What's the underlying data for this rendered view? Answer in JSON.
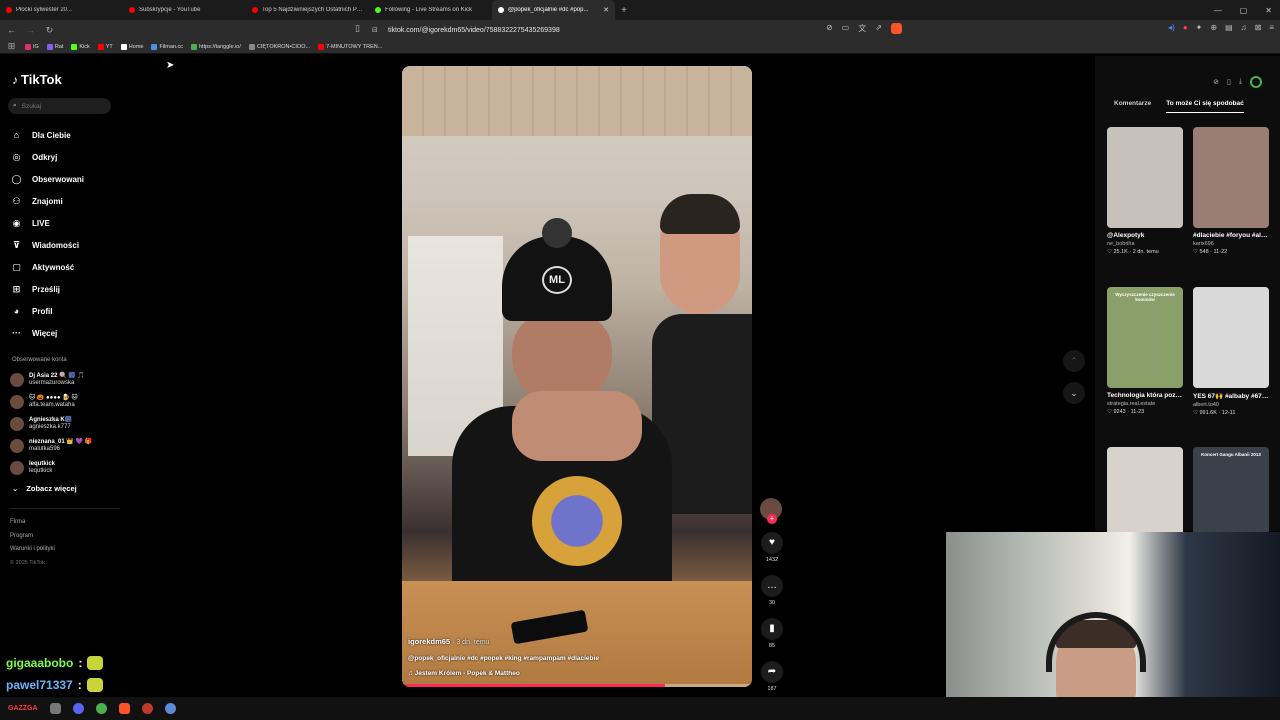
{
  "browser": {
    "tabs": [
      {
        "title": "Płocki sylwester 20...",
        "color": "#ff0000",
        "active": false
      },
      {
        "title": "Subskrypcje - YouTube",
        "color": "#ff0000",
        "active": false
      },
      {
        "title": "Top 5 Najdziwniejszych Ostatnich Po...",
        "color": "#ff0000",
        "active": false
      },
      {
        "title": "Following - Live Streams on Kick",
        "color": "#53fc18",
        "active": false
      },
      {
        "title": "@popek_oficjalnie #dc #pop...",
        "color": "#ffffff",
        "active": true
      }
    ],
    "new_tab_label": "+",
    "url": "tiktok.com/@igorekdm65/video/7588322275435269398",
    "bookmarks": [
      {
        "label": "IG",
        "color": "#e1306c"
      },
      {
        "label": "Rat",
        "color": "#8a5cf6"
      },
      {
        "label": "Kick",
        "color": "#53fc18"
      },
      {
        "label": "YT",
        "color": "#ff0000"
      },
      {
        "label": "Home",
        "color": "#ffffff"
      },
      {
        "label": "Filman.cc",
        "color": "#4a90e2"
      },
      {
        "label": "https://tanggle.io/",
        "color": "#4caf50"
      },
      {
        "label": "CIĘTOKRON•CIOO...",
        "color": "#888888"
      },
      {
        "label": "7-MINUTOWY TREN...",
        "color": "#ff0000"
      }
    ]
  },
  "sidebar": {
    "logo": "TikTok",
    "search_placeholder": "Szukaj",
    "menu": [
      {
        "label": "Dla Ciebie",
        "icon": "home-icon",
        "glyph": "⌂"
      },
      {
        "label": "Odkryj",
        "icon": "compass-icon",
        "glyph": "◎"
      },
      {
        "label": "Obserwowani",
        "icon": "following-icon",
        "glyph": "◯"
      },
      {
        "label": "Znajomi",
        "icon": "friends-icon",
        "glyph": "⚇"
      },
      {
        "label": "LIVE",
        "icon": "live-icon",
        "glyph": "◉"
      },
      {
        "label": "Wiadomości",
        "icon": "messages-icon",
        "glyph": "⊽"
      },
      {
        "label": "Aktywność",
        "icon": "activity-icon",
        "glyph": "▢"
      },
      {
        "label": "Prześlij",
        "icon": "upload-icon",
        "glyph": "⊞"
      },
      {
        "label": "Profil",
        "icon": "profile-icon",
        "glyph": "◕"
      },
      {
        "label": "Więcej",
        "icon": "more-icon",
        "glyph": "···"
      }
    ],
    "followed_title": "Obserwowane konta",
    "accounts": [
      {
        "name": "Dj Asia 22 🍭 🎆 🎵",
        "handle": "usermazurowska"
      },
      {
        "name": "🐱 🎃 ●●●● 🍺 🐱",
        "handle": "alfa.team.wataha"
      },
      {
        "name": "Agnieszka K🎆",
        "handle": "agnieszka.k777"
      },
      {
        "name": "nieznana_01 👑 💜 🎁",
        "handle": "malutka596"
      },
      {
        "name": "lequtkick",
        "handle": "lequtkick"
      }
    ],
    "see_more": "Zobacz więcej",
    "footer": [
      "Firma",
      "Program",
      "Warunki i polityki"
    ],
    "copyright": "© 2025 TikTok"
  },
  "video": {
    "author": "igorekdm65",
    "time_ago": "· 3 dn. temu",
    "description": "@popek_oficjalnie #dc #popek #king #rampampam #dlaciebie",
    "music": "♫  Jestem Królem - Popek & Mattheo",
    "hat_logo": "ML",
    "progress": 0.75
  },
  "actions": {
    "likes": "1432",
    "comments": "30",
    "saves": "85",
    "shares": "187"
  },
  "right_panel": {
    "tabs": {
      "comments": "Komentarze",
      "related": "To może Ci się spodobać"
    },
    "cards": [
      {
        "title": "@Alexpotyk",
        "user": "ne_bobriha",
        "meta": "♡ 25.1K · 2 dn. temu",
        "thumb": "#c7c1bb",
        "label": ""
      },
      {
        "title": "#dlaciebie #foryou #alberto...",
        "user": "karix696",
        "meta": "♡ 548 · 11-22",
        "thumb": "#9a7d74",
        "label": ""
      },
      {
        "title": "Technologia która pozwala szybko i...",
        "user": "strategia.real.estate",
        "meta": "♡ 9243 · 11-23",
        "thumb": "#8aa06a",
        "label": "Wyczyszczenie czyszczenie kominów"
      },
      {
        "title": "YES 67🙌 #albaby #67 #fyp #viral...",
        "user": "albert.to40",
        "meta": "♡ 991.6K · 12-11",
        "thumb": "#d9d9d9",
        "label": ""
      },
      {
        "title": "",
        "user": "",
        "meta": "",
        "thumb": "#d7d2cc",
        "label": ""
      },
      {
        "title": "",
        "user": "",
        "meta": "",
        "thumb": "#39424a",
        "label": "Koncert Gangu Albanii 2013"
      }
    ]
  },
  "chat": [
    {
      "user": "gigaaabobo",
      "sep": ":",
      "color": "#7dff4a"
    },
    {
      "user": "pawel71337",
      "sep": ":",
      "color": "#6ab4ff"
    }
  ],
  "taskbar": {
    "label": "GAZZGA"
  }
}
